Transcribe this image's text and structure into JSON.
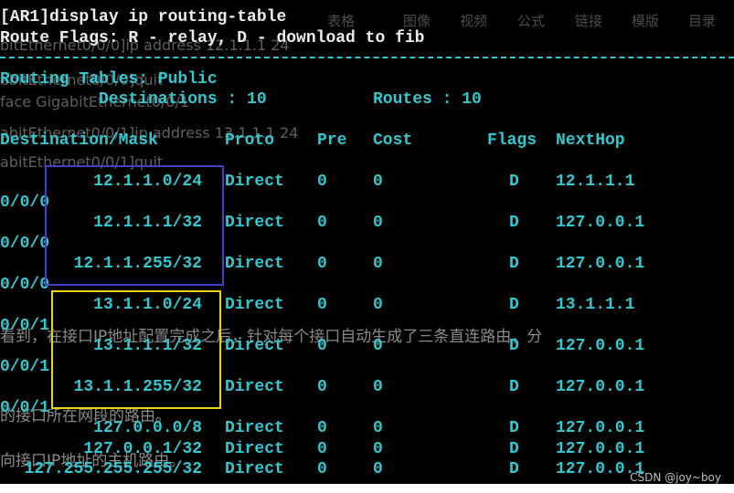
{
  "editor_toolbar": [
    {
      "name": "table",
      "label": "表格"
    },
    {
      "name": "image",
      "label": "图像"
    },
    {
      "name": "video",
      "label": "视频"
    },
    {
      "name": "formula",
      "label": "公式"
    },
    {
      "name": "link",
      "label": "链接"
    },
    {
      "name": "template",
      "label": "模版"
    },
    {
      "name": "toc",
      "label": "目录"
    }
  ],
  "ghost_lines": [
    "bitEthernet0/0/0]ip address 12.1.1.1 24",
    "abitEthernet0/0/0]quit",
    "face GigabitEthernet0/0/1",
    "abitEthernet0/0/1]ip address 13.1.1.1 24",
    "abitEthernet0/0/1]quit",
    "看到，在接口IP地址配置完成之后，针对每个接口自动生成了三条直连路由，分",
    "的接口所在网段的路由。",
    "向接口IP地址的主机路由。"
  ],
  "terminal": {
    "prompt": "[AR1]display ip routing-table",
    "flags_line": "Route Flags: R - relay, D - download to fib",
    "routing_tables": "Routing Tables: Public",
    "destinations_label": "Destinations : 10",
    "routes_label": "Routes : 10",
    "headers": {
      "dest": "Destination/Mask",
      "proto": "Proto",
      "pre": "Pre",
      "cost": "Cost",
      "flags": "Flags",
      "nexthop": "NextHop"
    },
    "rows": [
      {
        "dest": "12.1.1.0/24",
        "proto": "Direct",
        "pre": "0",
        "cost": "0",
        "flags": "D",
        "nexthop": "12.1.1.1",
        "iface": "0/0/0"
      },
      {
        "dest": "12.1.1.1/32",
        "proto": "Direct",
        "pre": "0",
        "cost": "0",
        "flags": "D",
        "nexthop": "127.0.0.1",
        "iface": "0/0/0"
      },
      {
        "dest": "12.1.1.255/32",
        "proto": "Direct",
        "pre": "0",
        "cost": "0",
        "flags": "D",
        "nexthop": "127.0.0.1",
        "iface": "0/0/0"
      },
      {
        "dest": "13.1.1.0/24",
        "proto": "Direct",
        "pre": "0",
        "cost": "0",
        "flags": "D",
        "nexthop": "13.1.1.1",
        "iface": "0/0/1"
      },
      {
        "dest": "13.1.1.1/32",
        "proto": "Direct",
        "pre": "0",
        "cost": "0",
        "flags": "D",
        "nexthop": "127.0.0.1",
        "iface": "0/0/1"
      },
      {
        "dest": "13.1.1.255/32",
        "proto": "Direct",
        "pre": "0",
        "cost": "0",
        "flags": "D",
        "nexthop": "127.0.0.1",
        "iface": "0/0/1"
      },
      {
        "dest": "127.0.0.0/8",
        "proto": "Direct",
        "pre": "0",
        "cost": "0",
        "flags": "D",
        "nexthop": "127.0.0.1",
        "iface": ""
      },
      {
        "dest": "127.0.0.1/32",
        "proto": "Direct",
        "pre": "0",
        "cost": "0",
        "flags": "D",
        "nexthop": "127.0.0.1",
        "iface": ""
      },
      {
        "dest": "127.255.255.255/32",
        "proto": "Direct",
        "pre": "0",
        "cost": "0",
        "flags": "D",
        "nexthop": "127.0.0.1",
        "iface": ""
      }
    ]
  },
  "watermark": "CSDN @joy~boy",
  "colors": {
    "terminal_text": "#31c8d0",
    "prompt_text": "#e9eef0",
    "background": "#000000",
    "blue_box": "#4040c8",
    "yellow_box": "#e8d21a"
  }
}
